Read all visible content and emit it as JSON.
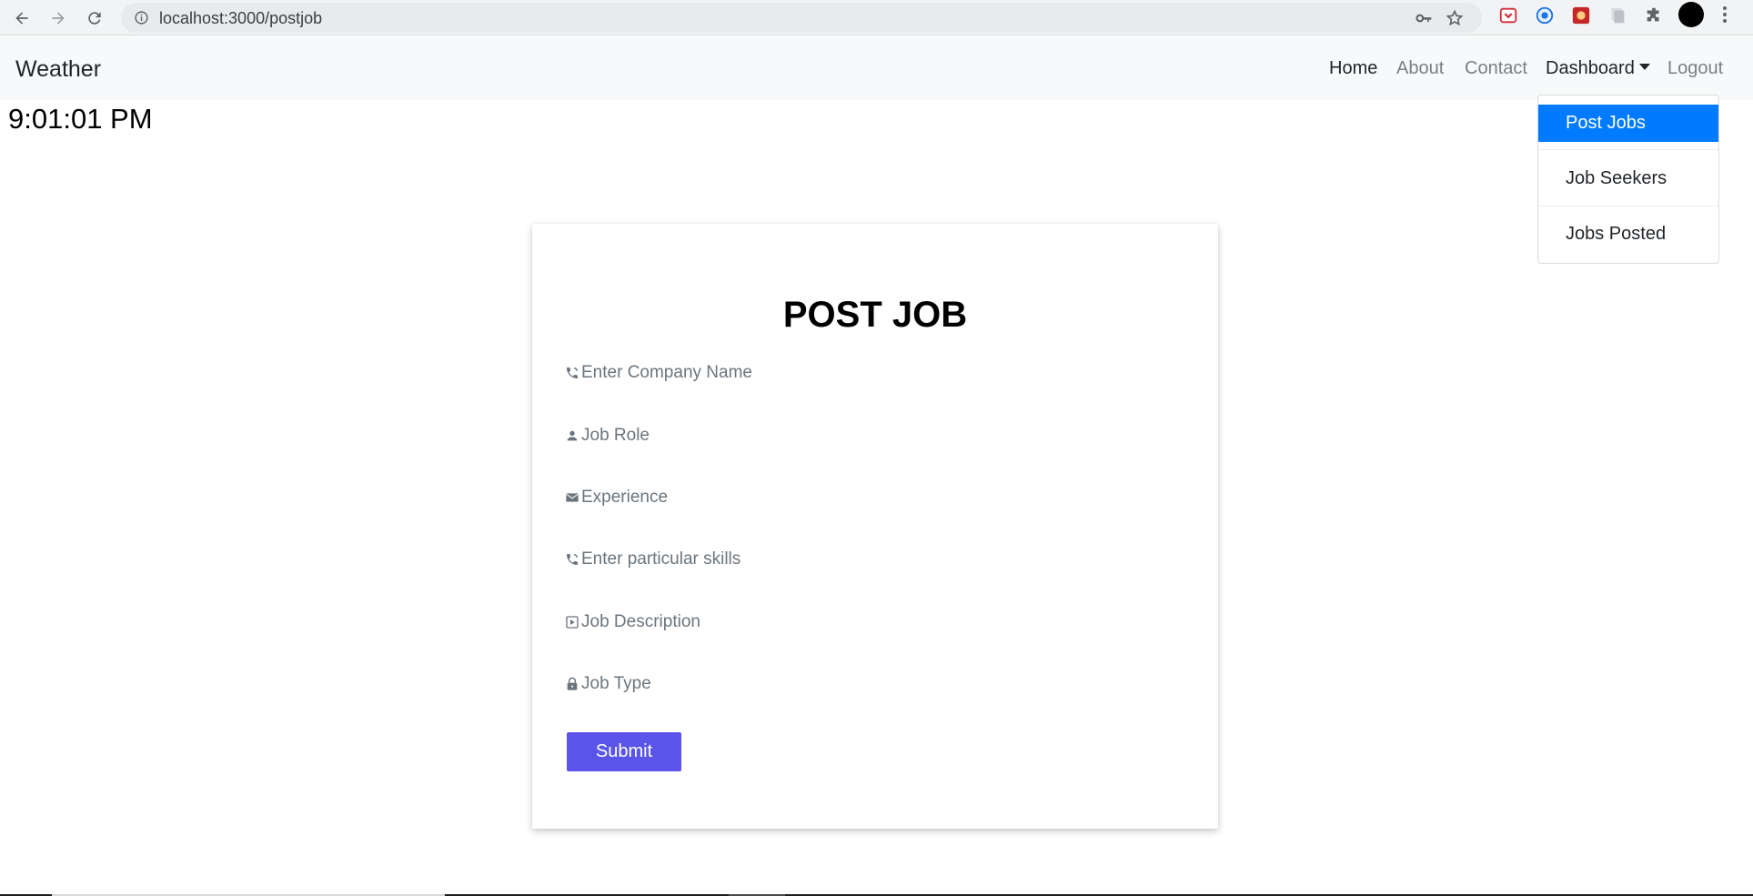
{
  "browser": {
    "url": "localhost:3000/postjob",
    "icons": [
      "back-arrow-icon",
      "forward-arrow-icon",
      "reload-icon",
      "info-icon",
      "key-icon",
      "star-icon",
      "extension-icons",
      "puzzle-icon",
      "profile-avatar",
      "menu-icon"
    ]
  },
  "navbar": {
    "brand": "Weather",
    "links": {
      "home": "Home",
      "about": "About",
      "contact": "Contact",
      "dashboard": "Dashboard",
      "logout": "Logout"
    }
  },
  "clock": "9:01:01 PM",
  "dropdown": {
    "items": [
      {
        "label": "Post Jobs",
        "active": true
      },
      {
        "label": "Job Seekers",
        "active": false
      },
      {
        "label": "Jobs Posted",
        "active": false
      }
    ]
  },
  "form": {
    "title": "POST JOB",
    "fields": [
      {
        "placeholder": "Enter Company Name",
        "icon": "phone-icon"
      },
      {
        "placeholder": "Job Role",
        "icon": "person-icon"
      },
      {
        "placeholder": "Experience",
        "icon": "mail-icon"
      },
      {
        "placeholder": "Enter particular skills",
        "icon": "phone-icon"
      },
      {
        "placeholder": "Job Description",
        "icon": "play-box-icon"
      },
      {
        "placeholder": "Job Type",
        "icon": "lock-icon"
      }
    ],
    "submit_label": "Submit"
  },
  "colors": {
    "active_dropdown": "#007bff",
    "submit_button": "#5a55e8",
    "navbar_bg": "#f8f9fa"
  }
}
